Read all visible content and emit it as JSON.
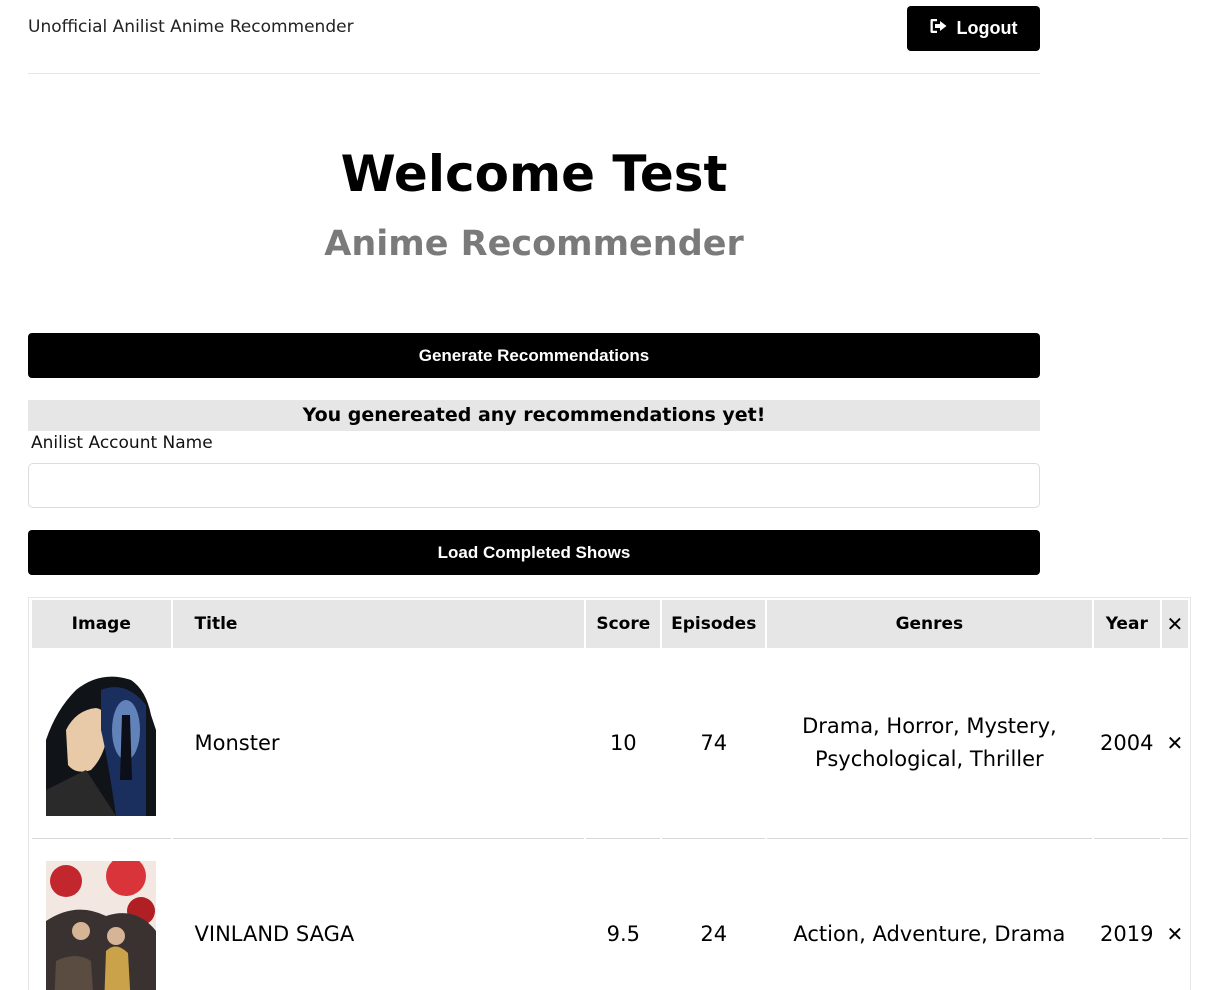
{
  "header": {
    "brand": "Unofficial Anilist Anime Recommender",
    "logout_label": "Logout"
  },
  "hero": {
    "title": "Welcome Test",
    "subtitle": "Anime Recommender"
  },
  "generate_label": "Generate Recommendations",
  "notice": "You genereated any recommendations yet!",
  "account": {
    "label": "Anilist Account Name",
    "value": ""
  },
  "load_label": "Load Completed Shows",
  "table": {
    "headers": {
      "image": "Image",
      "title": "Title",
      "score": "Score",
      "episodes": "Episodes",
      "genres": "Genres",
      "year": "Year",
      "remove": "✕"
    },
    "rows": [
      {
        "title": "Monster",
        "score": "10",
        "episodes": "74",
        "genres": "Drama, Horror, Mystery, Psychological, Thriller",
        "year": "2004",
        "remove": "✕"
      },
      {
        "title": "VINLAND SAGA",
        "score": "9.5",
        "episodes": "24",
        "genres": "Action, Adventure, Drama",
        "year": "2019",
        "remove": "✕"
      }
    ]
  },
  "colors": {
    "accent": "#000000",
    "muted_heading": "#7a7a7a",
    "panel": "#e6e6e6"
  },
  "icons": {
    "logout": "sign-out-icon",
    "remove": "close-icon"
  }
}
